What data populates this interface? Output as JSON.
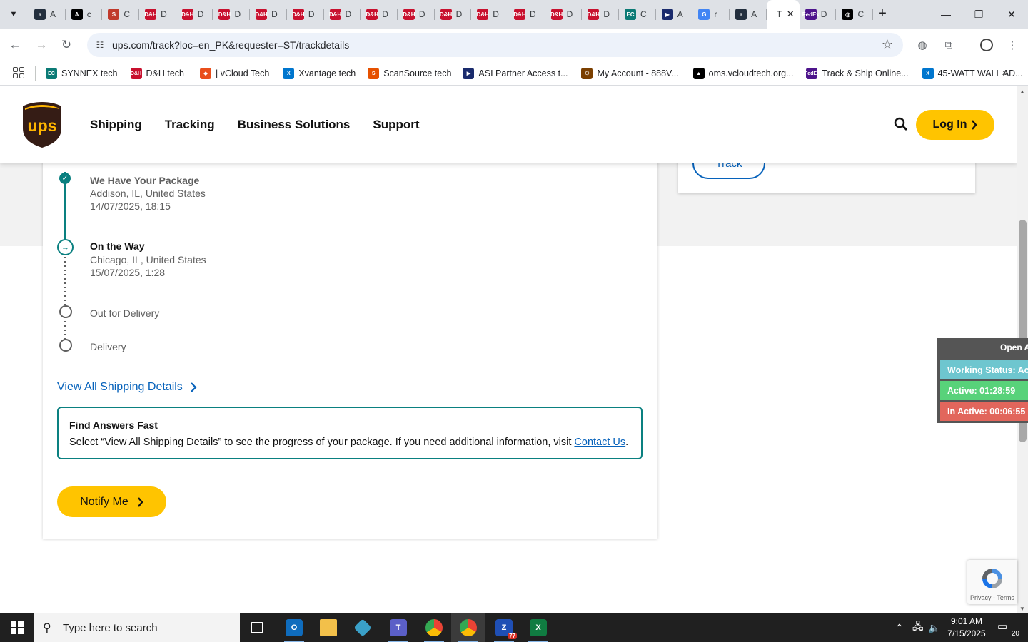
{
  "browser": {
    "tabs": [
      {
        "fav": "a",
        "color": "#232f3e",
        "title": "A"
      },
      {
        "fav": "A",
        "color": "#000000",
        "title": "c"
      },
      {
        "fav": "S",
        "color": "#c0392b",
        "title": "C"
      },
      {
        "fav": "D&H",
        "color": "#c8102e",
        "title": "D"
      },
      {
        "fav": "D&H",
        "color": "#c8102e",
        "title": "D"
      },
      {
        "fav": "D&H",
        "color": "#c8102e",
        "title": "D"
      },
      {
        "fav": "D&H",
        "color": "#c8102e",
        "title": "D"
      },
      {
        "fav": "D&H",
        "color": "#c8102e",
        "title": "D"
      },
      {
        "fav": "D&H",
        "color": "#c8102e",
        "title": "D"
      },
      {
        "fav": "D&H",
        "color": "#c8102e",
        "title": "D"
      },
      {
        "fav": "D&H",
        "color": "#c8102e",
        "title": "D"
      },
      {
        "fav": "D&H",
        "color": "#c8102e",
        "title": "D"
      },
      {
        "fav": "D&H",
        "color": "#c8102e",
        "title": "D"
      },
      {
        "fav": "D&H",
        "color": "#c8102e",
        "title": "D"
      },
      {
        "fav": "D&H",
        "color": "#c8102e",
        "title": "D"
      },
      {
        "fav": "D&H",
        "color": "#c8102e",
        "title": "D"
      },
      {
        "fav": "EC",
        "color": "#0b7a75",
        "title": "C"
      },
      {
        "fav": "▶",
        "color": "#1a2b6d",
        "title": "A"
      },
      {
        "fav": "G",
        "color": "#4285f4",
        "title": "r"
      },
      {
        "fav": "a",
        "color": "#232f3e",
        "title": "A"
      }
    ],
    "active_tab": {
      "title": "T"
    },
    "tabs_after": [
      {
        "fav": "FedEx",
        "color": "#4d148c",
        "title": "D"
      },
      {
        "fav": "◎",
        "color": "#000000",
        "title": "C"
      }
    ],
    "url": "ups.com/track?loc=en_PK&requester=ST/trackdetails",
    "bookmarks": [
      {
        "label": "SYNNEX tech",
        "fav": "EC",
        "color": "#0b7a75"
      },
      {
        "label": "D&H tech",
        "fav": "D&H",
        "color": "#c8102e"
      },
      {
        "label": "| vCloud Tech",
        "fav": "◆",
        "color": "#e94e1b"
      },
      {
        "label": "Xvantage tech",
        "fav": "X",
        "color": "#0076ce"
      },
      {
        "label": "ScanSource tech",
        "fav": "S",
        "color": "#e65100"
      },
      {
        "label": "ASI Partner Access t...",
        "fav": "▶",
        "color": "#1a2b6d"
      },
      {
        "label": "My Account - 888V...",
        "fav": "⚇",
        "color": "#7b3f00"
      },
      {
        "label": "oms.vcloudtech.org...",
        "fav": "▲",
        "color": "#000000"
      },
      {
        "label": "Track & Ship Online...",
        "fav": "FedEx",
        "color": "#4d148c"
      },
      {
        "label": "45-WATT WALL AD...",
        "fav": "X",
        "color": "#0076ce"
      }
    ]
  },
  "ups": {
    "nav": [
      "Shipping",
      "Tracking",
      "Business Solutions",
      "Support"
    ],
    "login": "Log In",
    "track_button": "Track",
    "timeline": [
      {
        "title": "We Have Your Package",
        "place": "Addison, IL, United States",
        "time": "14/07/2025, 18:15",
        "state": "done"
      },
      {
        "title": "On the Way",
        "place": "Chicago, IL, United States",
        "time": "15/07/2025, 1:28",
        "state": "current"
      },
      {
        "title": "Out for Delivery",
        "state": "pending"
      },
      {
        "title": "Delivery",
        "state": "pending"
      }
    ],
    "view_all": "View All Shipping Details",
    "answers": {
      "title": "Find Answers Fast",
      "text": "Select “View All Shipping Details” to see the progress of your package. If you need additional information, visit ",
      "link": "Contact Us",
      "suffix": "."
    },
    "notify": "Notify Me",
    "colors": {
      "brand_yellow": "#ffc400",
      "teal": "#0a8080",
      "link_blue": "#0662bb",
      "ups_brown": "#351c15"
    }
  },
  "widget": {
    "open": "Open A",
    "working": "Working Status: Acti",
    "active": "Active: 01:28:59",
    "inactive": "In Active: 00:06:55",
    "colors": {
      "working": "#6ec6cf",
      "active": "#58d27a",
      "inactive": "#e2665c"
    }
  },
  "recaptcha": {
    "text": "Privacy - Terms"
  },
  "taskbar": {
    "search_placeholder": "Type here to search",
    "time": "9:01 AM",
    "date": "7/15/2025",
    "notifications": "20",
    "zoom_badge": "77"
  }
}
